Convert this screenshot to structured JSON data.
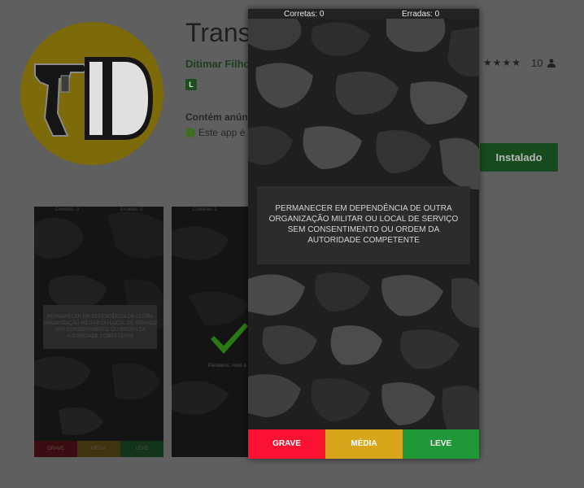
{
  "store_page": {
    "app_title": "Transc",
    "developer": "Ditimar Filho",
    "content_rating_badge": "L",
    "ads_label": "Contém anún",
    "ads_info": "Este app é",
    "review_count": "10",
    "install_button_label": "Instalado"
  },
  "screenshots": [
    {
      "correct_label": "Corretas: 0",
      "wrong_label": "Erradas: 0",
      "question": "PERMANECER EM DEPENDÊNCIA DE OUTRA ORGANIZAÇÃO MILITAR OU LOCAL DE SERVIÇO SEM CONSENTIMENTO OU ORDEM DA AUTORIDADE COMPETENTE",
      "buttons": [
        "GRAVE",
        "MÉDIA",
        "LEVE"
      ]
    },
    {
      "correct_label": "Corretas: 1",
      "congrats_text": "Parabéns, você a"
    }
  ],
  "app_window": {
    "correct_label": "Corretas: 0",
    "wrong_label": "Erradas: 0",
    "question": "PERMANECER EM DEPENDÊNCIA DE OUTRA ORGANIZAÇÃO MILITAR OU LOCAL DE SERVIÇO SEM CONSENTIMENTO OU ORDEM DA AUTORIDADE COMPETENTE",
    "answer_buttons": {
      "grave": "GRAVE",
      "media": "MÉDIA",
      "leve": "LEVE"
    }
  },
  "colors": {
    "grave": "#fb1233",
    "media": "#d9a61b",
    "leve": "#219838",
    "install_button": "#174b1e",
    "icon_background": "#7d6a0a"
  },
  "icons": [
    "app-logo-icon",
    "star-icon",
    "person-icon",
    "info-icon",
    "checkmark-icon"
  ]
}
